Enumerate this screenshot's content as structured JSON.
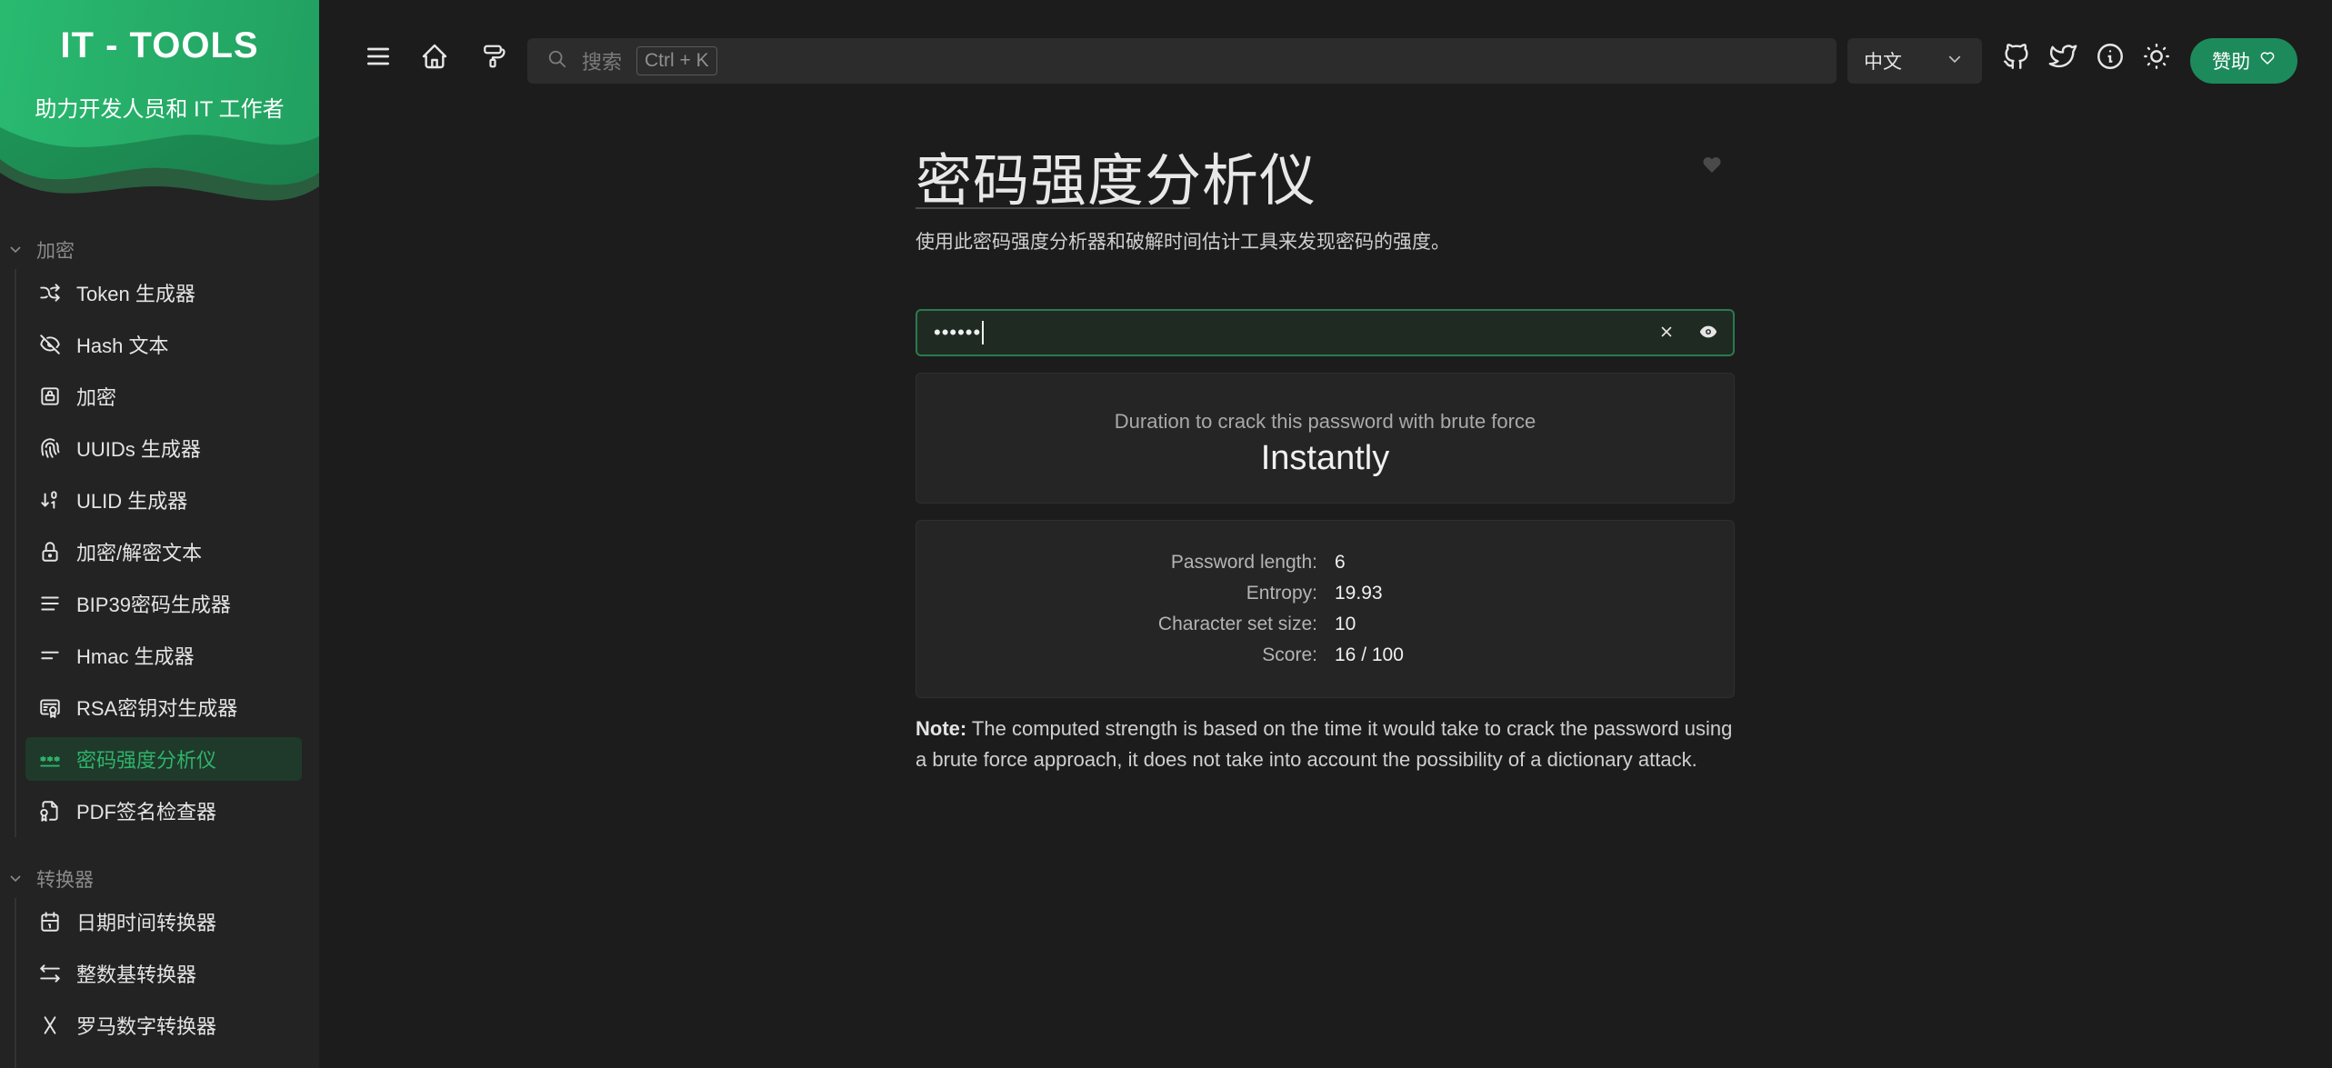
{
  "brand": {
    "title": "IT - TOOLS",
    "subtitle": "助力开发人员和 IT 工作者"
  },
  "sidebar": {
    "sections": [
      {
        "label": "加密"
      },
      {
        "label": "转换器"
      }
    ],
    "crypto_items": [
      {
        "label": "Token 生成器",
        "icon": "shuffle-icon"
      },
      {
        "label": "Hash 文本",
        "icon": "eye-off-icon"
      },
      {
        "label": "加密",
        "icon": "lock-square-icon"
      },
      {
        "label": "UUIDs 生成器",
        "icon": "fingerprint-icon"
      },
      {
        "label": "ULID 生成器",
        "icon": "sort-numeric-icon"
      },
      {
        "label": "加密/解密文本",
        "icon": "lock-icon"
      },
      {
        "label": "BIP39密码生成器",
        "icon": "align-justified-icon"
      },
      {
        "label": "Hmac 生成器",
        "icon": "short-text-icon"
      },
      {
        "label": "RSA密钥对生成器",
        "icon": "certificate-icon"
      },
      {
        "label": "密码强度分析仪",
        "icon": "password-icon",
        "active": true
      },
      {
        "label": "PDF签名检查器",
        "icon": "file-certificate-icon"
      }
    ],
    "converter_items": [
      {
        "label": "日期时间转换器",
        "icon": "calendar-icon"
      },
      {
        "label": "整数基转换器",
        "icon": "arrows-left-right-icon"
      },
      {
        "label": "罗马数字转换器",
        "icon": "letter-x-icon"
      }
    ]
  },
  "topbar": {
    "search_placeholder": "搜索",
    "search_shortcut": "Ctrl + K",
    "language": "中文",
    "sponsor_label": "赞助"
  },
  "main": {
    "title": "密码强度分析仪",
    "description": "使用此密码强度分析器和破解时间估计工具来发现密码的强度。",
    "password_masked": "••••••",
    "crack_label": "Duration to crack this password with brute force",
    "crack_value": "Instantly",
    "stats": [
      {
        "label": "Password length:",
        "value": "6"
      },
      {
        "label": "Entropy:",
        "value": "19.93"
      },
      {
        "label": "Character set size:",
        "value": "10"
      },
      {
        "label": "Score:",
        "value": "16 / 100"
      }
    ],
    "note_label": "Note:",
    "note_text": " The computed strength is based on the time it would take to crack the password using a brute force approach, it does not take into account the possibility of a dictionary attack."
  },
  "colors": {
    "accent": "#2fb36b",
    "sponsor": "#1d8a5b",
    "background": "#1c1c1c",
    "sidebar": "#232323"
  }
}
